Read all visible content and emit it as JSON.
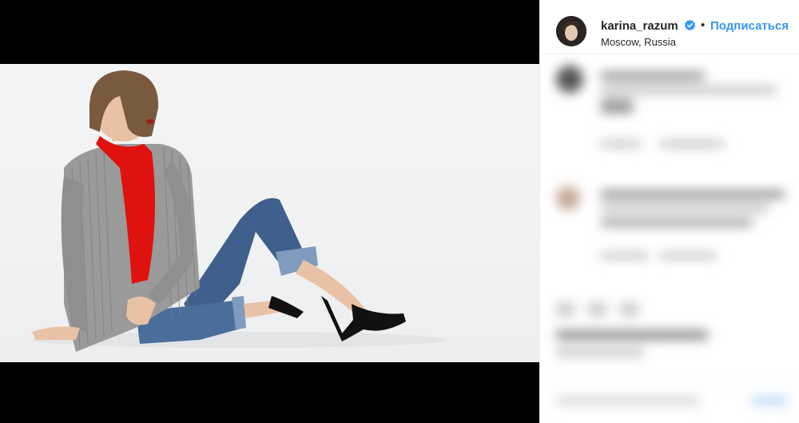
{
  "post": {
    "username": "karina_razum",
    "separator": "•",
    "follow_label": "Подписаться",
    "location": "Moscow, Russia"
  },
  "icons": {
    "verified": "verified-badge-icon",
    "avatar": "profile-avatar"
  },
  "colors": {
    "follow_blue": "#3897f0",
    "verified_blue": "#3897f0",
    "scarf_red": "#e0120f"
  }
}
